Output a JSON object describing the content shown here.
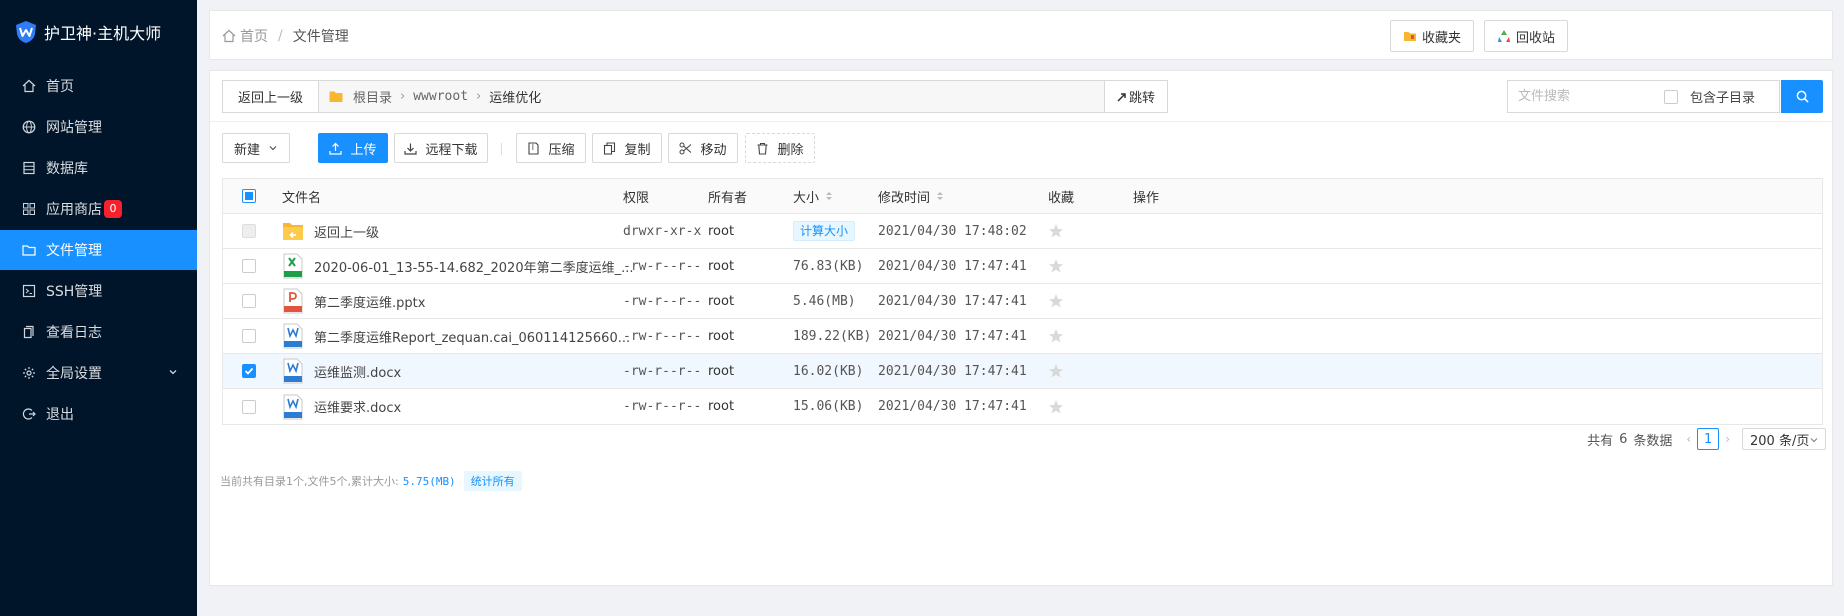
{
  "app": {
    "title": "护卫神·主机大师"
  },
  "sidebar": {
    "items": [
      {
        "label": "首页",
        "icon": "home-icon"
      },
      {
        "label": "网站管理",
        "icon": "globe-icon"
      },
      {
        "label": "数据库",
        "icon": "database-icon"
      },
      {
        "label": "应用商店",
        "icon": "app-grid-icon",
        "badge": "0"
      },
      {
        "label": "文件管理",
        "icon": "folder-icon",
        "active": true
      },
      {
        "label": "SSH管理",
        "icon": "terminal-icon"
      },
      {
        "label": "查看日志",
        "icon": "log-icon"
      },
      {
        "label": "全局设置",
        "icon": "gear-icon"
      },
      {
        "label": "退出",
        "icon": "logout-icon"
      }
    ]
  },
  "topbar": {
    "breadcrumb": {
      "home": "首页",
      "separator": "/",
      "current": "文件管理"
    },
    "favorites_label": "收藏夹",
    "recycle_label": "回收站"
  },
  "pathbar": {
    "back_label": "返回上一级",
    "crumbs": [
      "根目录",
      "wwwroot",
      "运维优化"
    ],
    "jump_label": "跳转"
  },
  "search": {
    "placeholder": "文件搜索",
    "include_sub_label": "包含子目录",
    "include_sub_checked": false
  },
  "toolbar": {
    "new_label": "新建",
    "upload_label": "上传",
    "remote_download_label": "远程下载",
    "compress_label": "压缩",
    "copy_label": "复制",
    "move_label": "移动",
    "delete_label": "删除"
  },
  "table": {
    "columns": [
      "文件名",
      "权限",
      "所有者",
      "大小",
      "修改时间",
      "收藏",
      "操作"
    ],
    "rows": [
      {
        "name": "返回上一级",
        "type": "folder-back",
        "permission": "drwxr-xr-x",
        "owner": "root",
        "size": "计算大小",
        "size_is_tag": true,
        "modified": "2021/04/30 17:48:02",
        "checked": false,
        "disabled": true
      },
      {
        "name": "2020-06-01_13-55-14.682_2020年第二季度运维_...",
        "type": "xlsx",
        "permission": "-rw-r--r--",
        "owner": "root",
        "size": "76.83(KB)",
        "modified": "2021/04/30 17:47:41",
        "checked": false
      },
      {
        "name": "第二季度运维.pptx",
        "type": "pptx",
        "permission": "-rw-r--r--",
        "owner": "root",
        "size": "5.46(MB)",
        "modified": "2021/04/30 17:47:41",
        "checked": false
      },
      {
        "name": "第二季度运维Report_zequan.cai_060114125660...",
        "type": "doc",
        "permission": "-rw-r--r--",
        "owner": "root",
        "size": "189.22(KB)",
        "modified": "2021/04/30 17:47:41",
        "checked": false
      },
      {
        "name": "运维监测.docx",
        "type": "docx",
        "permission": "-rw-r--r--",
        "owner": "root",
        "size": "16.02(KB)",
        "modified": "2021/04/30 17:47:41",
        "checked": true
      },
      {
        "name": "运维要求.docx",
        "type": "docx",
        "permission": "-rw-r--r--",
        "owner": "root",
        "size": "15.06(KB)",
        "modified": "2021/04/30 17:47:41",
        "checked": false
      }
    ]
  },
  "pager": {
    "total_prefix": "共有",
    "total": "6",
    "total_suffix": "条数据",
    "current_page": "1",
    "page_size": "200 条/页"
  },
  "footer": {
    "summary": "当前共有目录1个,文件5个,累计大小:",
    "total_size": "5.75(MB)",
    "stat_all_label": "统计所有"
  },
  "colors": {
    "accent": "#1890ff",
    "sidebar_bg": "#001529",
    "badge": "#f5222d"
  }
}
